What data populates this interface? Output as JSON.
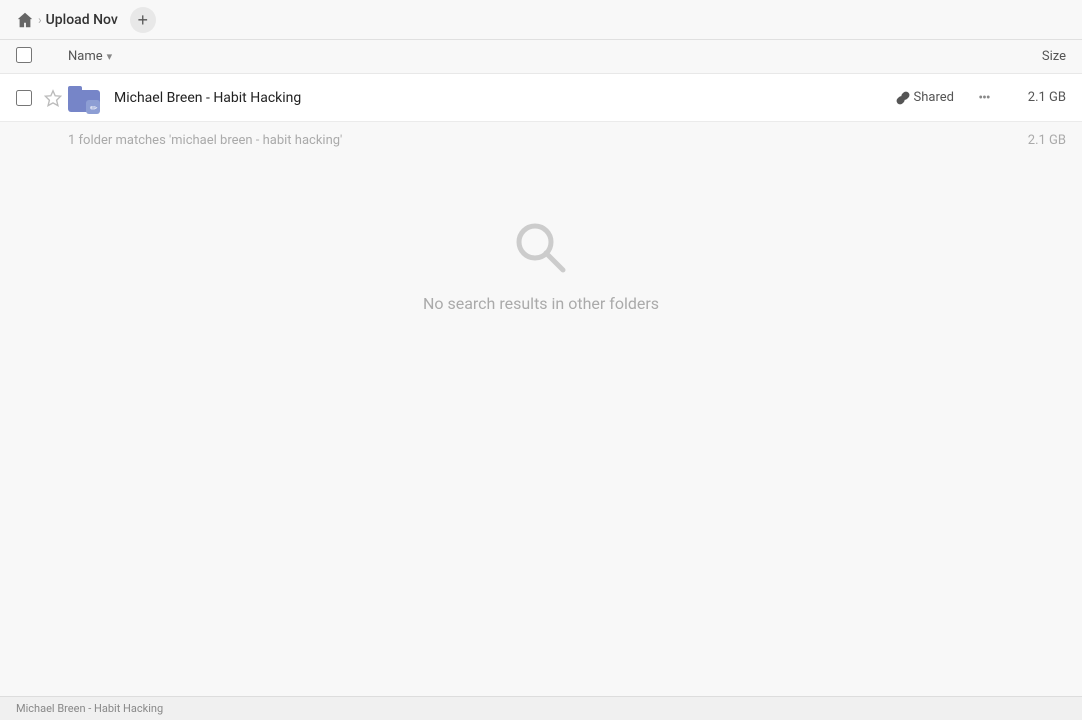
{
  "breadcrumb": {
    "home_icon": "home",
    "separator": ">",
    "current": "Upload Nov",
    "add_label": "+"
  },
  "columns": {
    "name_label": "Name",
    "sort_icon": "▾",
    "size_label": "Size"
  },
  "file_row": {
    "name": "Michael Breen - Habit Hacking",
    "shared_label": "Shared",
    "size": "2.1 GB",
    "more_icon": "•••"
  },
  "summary": {
    "text": "1 folder matches 'michael breen - habit hacking'",
    "size": "2.1 GB"
  },
  "empty_state": {
    "message": "No search results in other folders"
  },
  "status_bar": {
    "text": "Michael Breen - Habit Hacking"
  },
  "icons": {
    "home": "⌂",
    "star_empty": "☆",
    "link": "🔗",
    "search": "🔍"
  }
}
